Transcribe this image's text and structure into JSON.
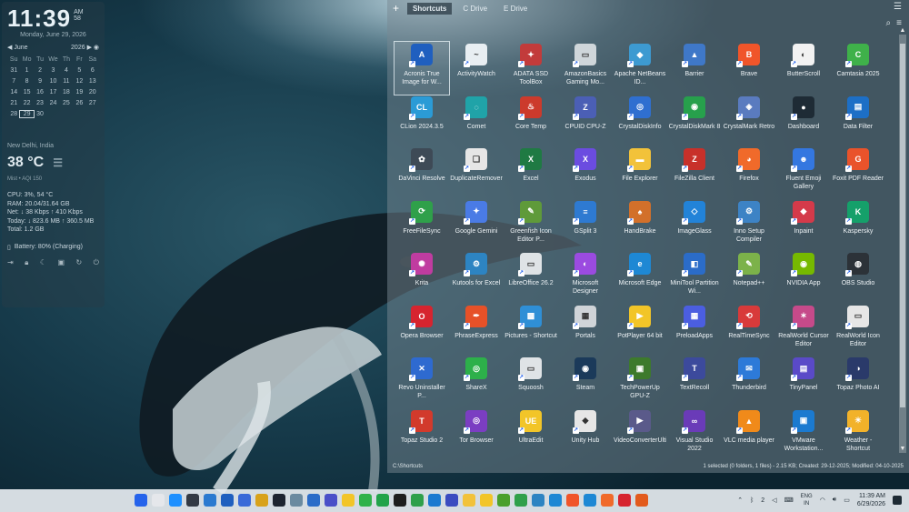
{
  "widget": {
    "time": "11:39",
    "ampm": "AM",
    "seconds": "58",
    "date": "Monday, June 29, 2026",
    "calendar": {
      "month": "June",
      "year": "2026",
      "day_headers": [
        "Su",
        "Mo",
        "Tu",
        "We",
        "Th",
        "Fr",
        "Sa"
      ],
      "rows": [
        [
          "31",
          "1",
          "2",
          "3",
          "4",
          "5",
          "6"
        ],
        [
          "7",
          "8",
          "9",
          "10",
          "11",
          "12",
          "13"
        ],
        [
          "14",
          "15",
          "16",
          "17",
          "18",
          "19",
          "20"
        ],
        [
          "21",
          "22",
          "23",
          "24",
          "25",
          "26",
          "27"
        ],
        [
          "28",
          "29",
          "30",
          "",
          "",
          "",
          ""
        ]
      ],
      "today": "29"
    },
    "weather": {
      "location": "New Delhi, India",
      "temp": "38 °C",
      "sub": "Mist • AQI 150"
    },
    "stats": [
      "CPU: 3%, 54 °C",
      "RAM: 20.04/31.64 GB",
      "Net: ↓ 38 Kbps ↑ 410 Kbps",
      "Today: ↓ 823.6 MB ↑ 360.5 MB",
      "Total: 1.2 GB"
    ],
    "battery": "Battery: 80% (Charging)"
  },
  "window": {
    "tabs": [
      "Shortcuts",
      "C Drive",
      "E Drive"
    ],
    "active_tab": "Shortcuts",
    "items": [
      {
        "label": "Acronis True Image for W...",
        "color": "#1f5fbf",
        "glyph": "A",
        "selected": true
      },
      {
        "label": "ActivityWatch",
        "color": "#e8eef2",
        "glyph": "~"
      },
      {
        "label": "ADATA SSD ToolBox",
        "color": "#c23b3b",
        "glyph": "✦"
      },
      {
        "label": "AmazonBasics Gaming Mo...",
        "color": "#cfd6da",
        "glyph": "▭"
      },
      {
        "label": "Apache NetBeans ID...",
        "color": "#3d9ad1",
        "glyph": "◆"
      },
      {
        "label": "Barrier",
        "color": "#3f78c8",
        "glyph": "▲"
      },
      {
        "label": "Brave",
        "color": "#f0552a",
        "glyph": "B"
      },
      {
        "label": "ButterScroll",
        "color": "#f2f2f2",
        "glyph": "◐"
      },
      {
        "label": "Camtasia 2025",
        "color": "#3fb14a",
        "glyph": "C"
      },
      {
        "label": "CLion 2024.3.5",
        "color": "#2b9bd6",
        "glyph": "CL"
      },
      {
        "label": "Comet",
        "color": "#20a3a8",
        "glyph": "◌"
      },
      {
        "label": "Core Temp",
        "color": "#cc3a2c",
        "glyph": "♨"
      },
      {
        "label": "CPUID CPU-Z",
        "color": "#4b5fb5",
        "glyph": "Z"
      },
      {
        "label": "CrystalDiskInfo",
        "color": "#2f6fd0",
        "glyph": "◎"
      },
      {
        "label": "CrystalDiskMark 8",
        "color": "#27a04c",
        "glyph": "◉"
      },
      {
        "label": "CrystalMark Retro",
        "color": "#5a7bbf",
        "glyph": "◈"
      },
      {
        "label": "Dashboard",
        "color": "#1e2b35",
        "glyph": "●"
      },
      {
        "label": "Data Filter",
        "color": "#1d6fc6",
        "glyph": "▤"
      },
      {
        "label": "DaVinci Resolve",
        "color": "#3e4a56",
        "glyph": "✿"
      },
      {
        "label": "DuplicateRemover",
        "color": "#e6e6e6",
        "glyph": "❏"
      },
      {
        "label": "Excel",
        "color": "#1f7a43",
        "glyph": "X"
      },
      {
        "label": "Exodus",
        "color": "#6b4ce0",
        "glyph": "X"
      },
      {
        "label": "File Explorer",
        "color": "#f2c23a",
        "glyph": "▬"
      },
      {
        "label": "FileZilla Client",
        "color": "#c8302a",
        "glyph": "Z"
      },
      {
        "label": "Firefox",
        "color": "#f06a2a",
        "glyph": "◕"
      },
      {
        "label": "Fluent Emoji Gallery",
        "color": "#3477e0",
        "glyph": "☻"
      },
      {
        "label": "Foxit PDF Reader",
        "color": "#e9532b",
        "glyph": "G"
      },
      {
        "label": "FreeFileSync",
        "color": "#2fa04a",
        "glyph": "⟳"
      },
      {
        "label": "Google Gemini",
        "color": "#4a7be5",
        "glyph": "✦"
      },
      {
        "label": "Greenfish Icon Editor P...",
        "color": "#5f9a3a",
        "glyph": "✎"
      },
      {
        "label": "GSplit 3",
        "color": "#2e7ad1",
        "glyph": "≡"
      },
      {
        "label": "HandBrake",
        "color": "#d2702a",
        "glyph": "♠"
      },
      {
        "label": "ImageGlass",
        "color": "#2283d8",
        "glyph": "◇"
      },
      {
        "label": "Inno Setup Compiler",
        "color": "#3d83c5",
        "glyph": "⚙"
      },
      {
        "label": "Inpaint",
        "color": "#d43a4a",
        "glyph": "◆"
      },
      {
        "label": "Kaspersky",
        "color": "#15a06a",
        "glyph": "K"
      },
      {
        "label": "Krita",
        "color": "#c03ca0",
        "glyph": "✺"
      },
      {
        "label": "Kutools for Excel",
        "color": "#2d84c2",
        "glyph": "⚙"
      },
      {
        "label": "LibreOffice 26.2",
        "color": "#dfe3e6",
        "glyph": "▭"
      },
      {
        "label": "Microsoft Designer",
        "color": "#9b4be0",
        "glyph": "◐"
      },
      {
        "label": "Microsoft Edge",
        "color": "#1e88d4",
        "glyph": "e"
      },
      {
        "label": "MiniTool Partition Wi...",
        "color": "#2b6cc8",
        "glyph": "◧"
      },
      {
        "label": "Notepad++",
        "color": "#7cb24a",
        "glyph": "✎"
      },
      {
        "label": "NVIDIA App",
        "color": "#76b900",
        "glyph": "◉"
      },
      {
        "label": "OBS Studio",
        "color": "#2c3238",
        "glyph": "◍"
      },
      {
        "label": "Opera Browser",
        "color": "#d6242f",
        "glyph": "O"
      },
      {
        "label": "PhraseExpress",
        "color": "#e65128",
        "glyph": "✒"
      },
      {
        "label": "Pictures - Shortcut",
        "color": "#2f8fd6",
        "glyph": "▩"
      },
      {
        "label": "Portals",
        "color": "#d0d4d8",
        "glyph": "▦"
      },
      {
        "label": "PotPlayer 64 bit",
        "color": "#f2c528",
        "glyph": "▶"
      },
      {
        "label": "PreloadApps",
        "color": "#4b5ee0",
        "glyph": "▦"
      },
      {
        "label": "RealTimeSync",
        "color": "#d83a3a",
        "glyph": "⟲"
      },
      {
        "label": "RealWorld Cursor Editor",
        "color": "#c64a8a",
        "glyph": "✶"
      },
      {
        "label": "RealWorld Icon Editor",
        "color": "#e6e6e6",
        "glyph": "▭"
      },
      {
        "label": "Revo Uninstaller P...",
        "color": "#2e6ad0",
        "glyph": "✕"
      },
      {
        "label": "ShareX",
        "color": "#2db04a",
        "glyph": "◎"
      },
      {
        "label": "Squoosh",
        "color": "#dfe3e6",
        "glyph": "▭"
      },
      {
        "label": "Steam",
        "color": "#1b3a5a",
        "glyph": "◉"
      },
      {
        "label": "TechPowerUp GPU-Z",
        "color": "#3d7a2c",
        "glyph": "▣"
      },
      {
        "label": "TextRecoll",
        "color": "#3c4a9c",
        "glyph": "T"
      },
      {
        "label": "Thunderbird",
        "color": "#2d7ad8",
        "glyph": "✉"
      },
      {
        "label": "TinyPanel",
        "color": "#5a4ac8",
        "glyph": "▤"
      },
      {
        "label": "Topaz Photo AI",
        "color": "#2a3a6a",
        "glyph": "◑"
      },
      {
        "label": "Topaz Studio 2",
        "color": "#d23a2c",
        "glyph": "T"
      },
      {
        "label": "Tor Browser",
        "color": "#7b3ec2",
        "glyph": "◎"
      },
      {
        "label": "UltraEdit",
        "color": "#f2c528",
        "glyph": "UE"
      },
      {
        "label": "Unity Hub",
        "color": "#e6e6e6",
        "glyph": "◆"
      },
      {
        "label": "VideoConverterUltimate",
        "color": "#5a5a8a",
        "glyph": "▶"
      },
      {
        "label": "Visual Studio 2022",
        "color": "#6a3bb8",
        "glyph": "∞"
      },
      {
        "label": "VLC media player",
        "color": "#f08a1a",
        "glyph": "▲"
      },
      {
        "label": "VMware Workstation...",
        "color": "#1b7ad0",
        "glyph": "▣"
      },
      {
        "label": "Weather - Shortcut",
        "color": "#f2b22a",
        "glyph": "☀"
      }
    ],
    "status_left": "C:\\Shortcuts",
    "status_right": "1 selected (0 folders, 1 files) - 2.15 KB; Created: 29-12-2025; Modified: 04-10-2025"
  },
  "taskbar": {
    "apps": [
      "#2563eb",
      "#e5e7eb",
      "#1e90ff",
      "#333a44",
      "#2b7ad0",
      "#1f5fbf",
      "#3a6ad8",
      "#d8a21a",
      "#1d2430",
      "#6a8aa0",
      "#2b6cc8",
      "#4a4fc8",
      "#f2c528",
      "#2fb24a",
      "#22a34a",
      "#1e1e1e",
      "#2fa04a",
      "#1b7ad0",
      "#3b4cc0",
      "#f2c23a",
      "#f2c528",
      "#4aa02c",
      "#2fa04a",
      "#2d84c2",
      "#1e88d4",
      "#f0552a",
      "#1e88d4",
      "#f06a2a",
      "#d6242f",
      "#e25a1c"
    ],
    "lang_top": "ENG",
    "lang_bottom": "IN",
    "clock_time": "11:39 AM",
    "clock_date": "6/29/2026",
    "tray_count": "2"
  }
}
